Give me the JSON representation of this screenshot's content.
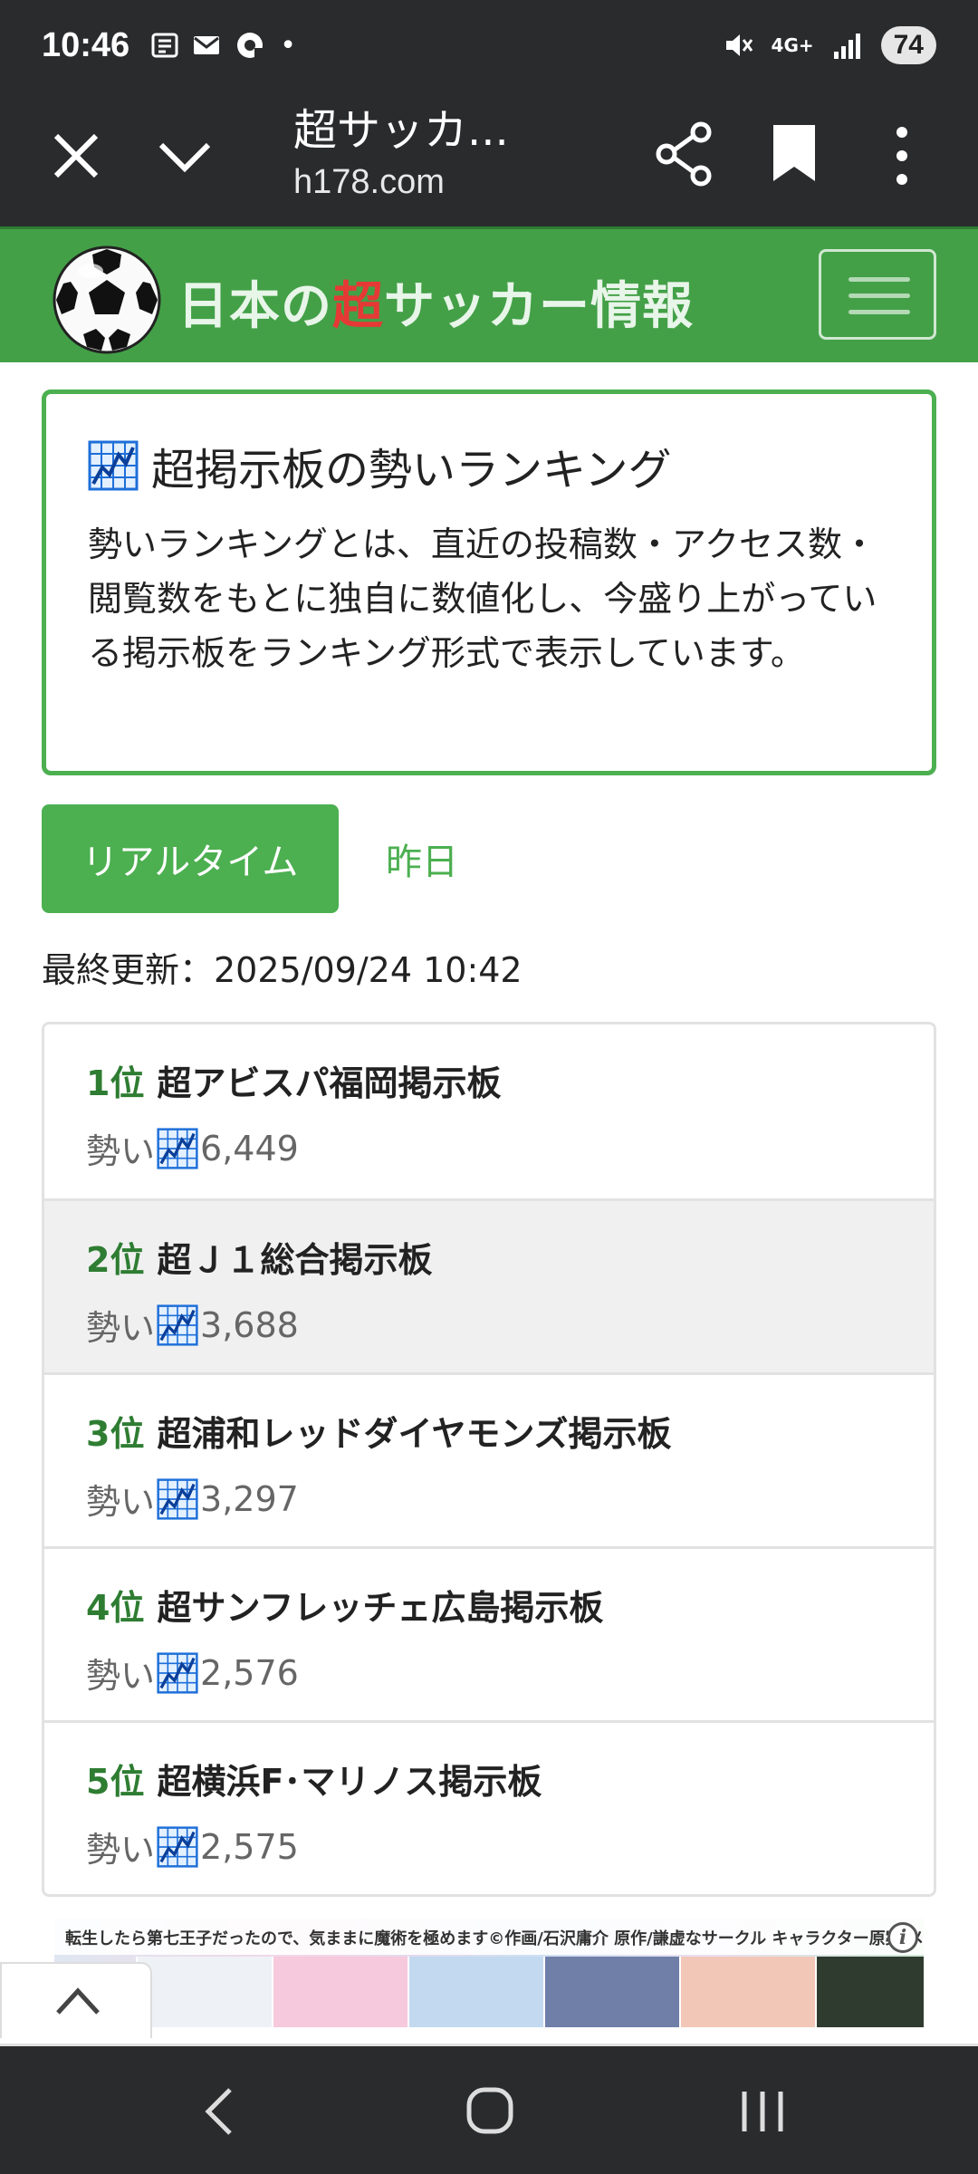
{
  "status_bar": {
    "time": "10:46",
    "signal_label": "4G+",
    "battery": "74"
  },
  "browser": {
    "title": "超サッカ...",
    "domain": "h178.com"
  },
  "site": {
    "title_before": "日本の",
    "title_highlight": "超",
    "title_after": "サッカー情報",
    "accent_color": "#4caf50",
    "highlight_color": "#e53935"
  },
  "intro": {
    "heading": "超掲示板の勢いランキング",
    "text": "勢いランキングとは、直近の投稿数・アクセス数・閲覧数をもとに独自に数値化し、今盛り上がっている掲示板をランキング形式で表示しています。"
  },
  "tabs": {
    "realtime": "リアルタイム",
    "yesterday": "昨日"
  },
  "last_updated": "最終更新：2025/09/24 10:42",
  "rankings": [
    {
      "rank": "1位",
      "name": "超アビスパ福岡掲示板",
      "score_label": "勢い",
      "score": "6,449"
    },
    {
      "rank": "2位",
      "name": "超Ｊ１総合掲示板",
      "score_label": "勢い",
      "score": "3,688"
    },
    {
      "rank": "3位",
      "name": "超浦和レッドダイヤモンズ掲示板",
      "score_label": "勢い",
      "score": "3,297"
    },
    {
      "rank": "4位",
      "name": "超サンフレッチェ広島掲示板",
      "score_label": "勢い",
      "score": "2,576"
    },
    {
      "rank": "5位",
      "name": "超横浜F･マリノス掲示板",
      "score_label": "勢い",
      "score": "2,575"
    }
  ],
  "ad": {
    "caption": "転生したら第七王子だったので、気ままに魔術を極めます©作画/石沢庸介 原作/謙虚なサークル キャラクター原案/メル。/講談社",
    "info": "i"
  }
}
